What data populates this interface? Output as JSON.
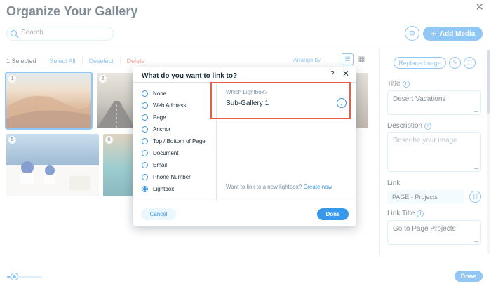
{
  "header": {
    "title": "Organize Your Gallery",
    "close_glyph": "✕"
  },
  "search": {
    "placeholder": "Search",
    "icon": "search-icon"
  },
  "actions": {
    "gear_glyph": "⚙",
    "add_media_label": "Add Media",
    "add_media_glyph": "+"
  },
  "toolbar": {
    "selected_count": "1 Selected",
    "select_all": "Select All",
    "deselect": "Deselect",
    "delete": "Delete",
    "arrange_by": "Arrange by"
  },
  "gallery": {
    "items": [
      {
        "num": "1",
        "name": "Desert Vacations",
        "selected": true
      },
      {
        "num": "2",
        "name": "",
        "selected": false
      },
      {
        "num": "5",
        "name": "",
        "selected": false
      },
      {
        "num": "6",
        "name": "",
        "selected": false
      }
    ]
  },
  "details": {
    "replace_image": "Replace Image",
    "title_label": "Title",
    "title_value": "Desert Vacations",
    "description_label": "Description",
    "description_placeholder": "Describe your image",
    "link_label": "Link",
    "link_value": "PAGE - Projects",
    "link_title_label": "Link Title",
    "link_title_value": "Go to Page Projects"
  },
  "footer": {
    "done": "Done"
  },
  "dialog": {
    "title": "What do you want to link to?",
    "help_glyph": "?",
    "close_glyph": "✕",
    "options": [
      {
        "label": "None",
        "selected": false
      },
      {
        "label": "Web Address",
        "selected": false
      },
      {
        "label": "Page",
        "selected": false
      },
      {
        "label": "Anchor",
        "selected": false
      },
      {
        "label": "Top / Bottom of Page",
        "selected": false
      },
      {
        "label": "Document",
        "selected": false
      },
      {
        "label": "Email",
        "selected": false
      },
      {
        "label": "Phone Number",
        "selected": false
      },
      {
        "label": "Lightbox",
        "selected": true
      }
    ],
    "lightbox_label": "Which Lightbox?",
    "lightbox_value": "Sub-Gallery 1",
    "new_lightbox_text": "Want to link to a new lightbox?",
    "create_now": "Create now",
    "cancel": "Cancel",
    "done": "Done"
  },
  "colors": {
    "accent": "#3899ec",
    "highlight": "#e85d4a",
    "title": "#162d3d"
  }
}
